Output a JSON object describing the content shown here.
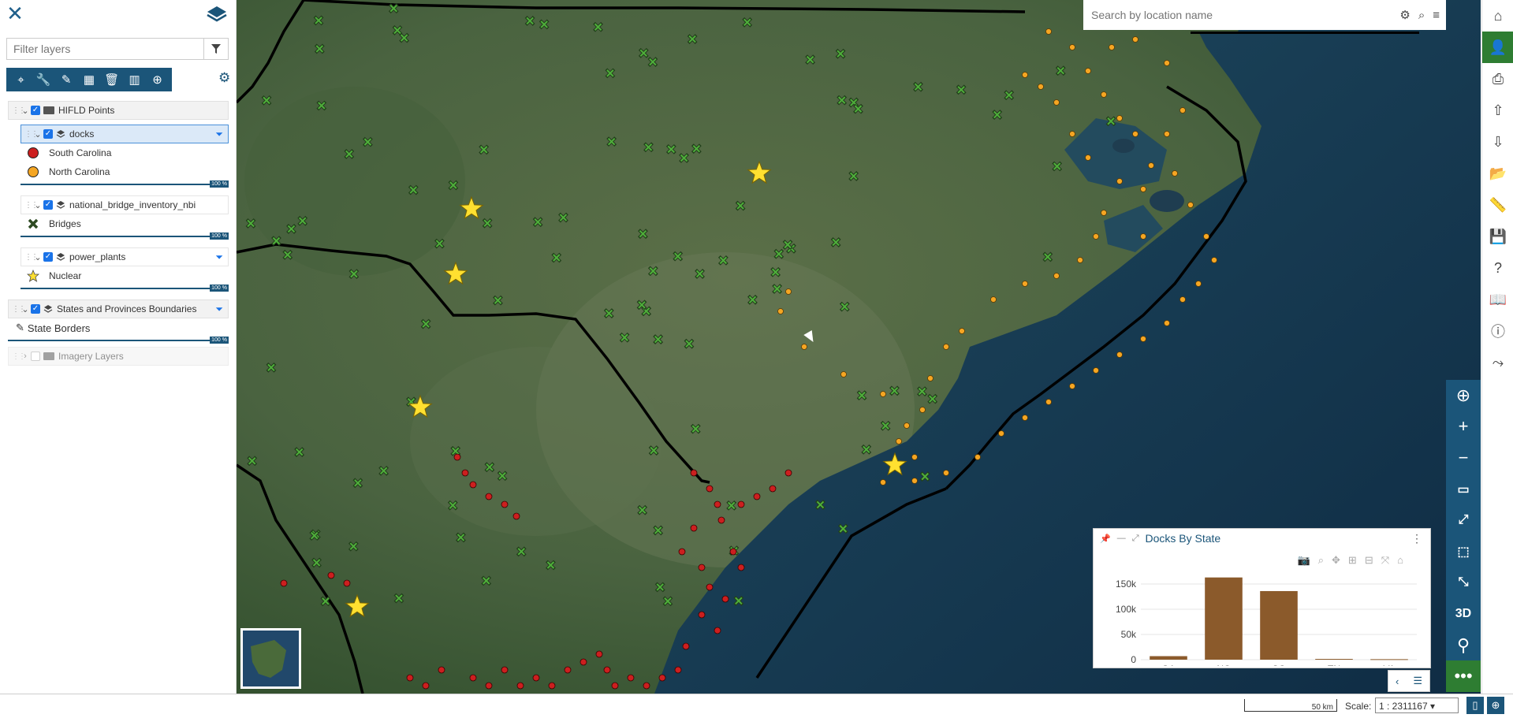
{
  "sidebar": {
    "filter_placeholder": "Filter layers",
    "toolbar_icons": [
      "zoom-to-icon",
      "wrench-icon",
      "style-icon",
      "table-icon",
      "trash-icon",
      "chart-icon",
      "download-icon"
    ],
    "groups": [
      {
        "label": "HIFLD Points"
      },
      {
        "label": "States and Provinces Boundaries"
      },
      {
        "label": "Imagery Layers"
      }
    ],
    "layers": [
      {
        "label": "docks",
        "legend": [
          "South Carolina",
          "North Carolina"
        ]
      },
      {
        "label": "national_bridge_inventory_nbi",
        "legend": [
          "Bridges"
        ]
      },
      {
        "label": "power_plants",
        "legend": [
          "Nuclear"
        ]
      }
    ],
    "state_borders": "State Borders",
    "opacity": "100 %"
  },
  "search": {
    "placeholder": "Search by location name"
  },
  "chart_panel": {
    "title": "Docks By State"
  },
  "chart_data": {
    "type": "bar",
    "categories": [
      "GA",
      "NC",
      "SC",
      "TN",
      "VA"
    ],
    "values": [
      7000,
      163000,
      136000,
      1500,
      1000
    ],
    "yticks": [
      "0",
      "50k",
      "100k",
      "150k"
    ],
    "ylim": [
      0,
      175000
    ],
    "color": "#8b5a2b",
    "grid": true
  },
  "bottom": {
    "scale_bar": "50 km",
    "scale_label": "Scale:",
    "scale_value": "1 : 2311167"
  },
  "map_controls": [
    "locate-icon",
    "zoom-in-icon",
    "zoom-out-icon",
    "extent-icon",
    "fullscreen-icon",
    "select-icon",
    "expand-icon",
    "3D",
    "pin-icon",
    "more-icon"
  ],
  "colors": {
    "accent": "#1b5579",
    "sc_dock": "#cc1f1f",
    "nc_dock": "#f5a623",
    "nuclear": "#ffe030",
    "active": "#2e7d32"
  }
}
